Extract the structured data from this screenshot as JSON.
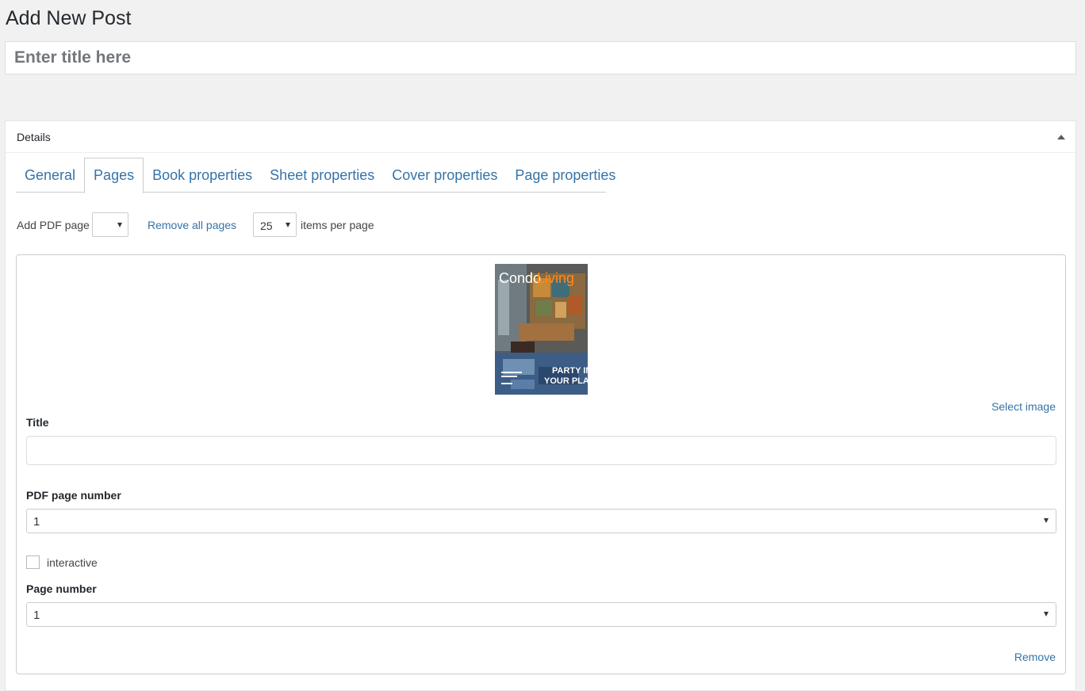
{
  "page": {
    "title": "Add New Post"
  },
  "title_field": {
    "placeholder": "Enter title here",
    "value": ""
  },
  "details": {
    "heading": "Details",
    "tabs": [
      {
        "label": "General",
        "active": false
      },
      {
        "label": "Pages",
        "active": true
      },
      {
        "label": "Book properties",
        "active": false
      },
      {
        "label": "Sheet properties",
        "active": false
      },
      {
        "label": "Cover properties",
        "active": false
      },
      {
        "label": "Page properties",
        "active": false
      }
    ],
    "toolbar": {
      "add_pdf_label": "Add PDF page",
      "add_pdf_value": "",
      "remove_all_label": "Remove all pages",
      "per_page_value": "25",
      "per_page_label": "items per page"
    },
    "page_item": {
      "thumbnail": {
        "logo_part1": "Condo",
        "logo_part2": "Living",
        "headline_line1": "PARTY IN",
        "headline_line2": "YOUR PLACE"
      },
      "select_image_label": "Select image",
      "title_label": "Title",
      "title_value": "",
      "pdf_page_number_label": "PDF page number",
      "pdf_page_number_value": "1",
      "interactive_label": "interactive",
      "interactive_checked": false,
      "page_number_label": "Page number",
      "page_number_value": "1",
      "remove_label": "Remove"
    }
  },
  "colors": {
    "background": "#f1f1f1",
    "link": "#3573a8",
    "panel": "#ffffff",
    "border": "#cccccc"
  }
}
